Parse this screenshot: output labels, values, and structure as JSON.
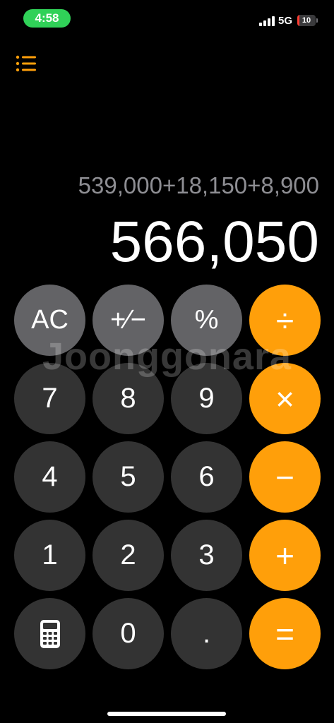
{
  "status_bar": {
    "time": "4:58",
    "network": "5G",
    "battery_level": "10",
    "battery_percent": 10,
    "signal_bars": 4,
    "time_pill_color": "#30d158",
    "battery_color": "#ff3b30"
  },
  "history_icon": "list-icon",
  "display": {
    "expression": "539,000+18,150+8,900",
    "result": "566,050"
  },
  "keys": {
    "ac": "AC",
    "plus_minus": "+∕−",
    "percent": "%",
    "divide": "÷",
    "seven": "7",
    "eight": "8",
    "nine": "9",
    "multiply": "×",
    "four": "4",
    "five": "5",
    "six": "6",
    "minus": "−",
    "one": "1",
    "two": "2",
    "three": "3",
    "plus": "+",
    "calculator_icon": "calculator-icon",
    "zero": "0",
    "decimal": ".",
    "equals": "="
  },
  "colors": {
    "operator": "#ff9f0a",
    "function": "#636366",
    "digit": "#333333",
    "accent": "#ff9f0a"
  },
  "watermark": "Joonggonara"
}
